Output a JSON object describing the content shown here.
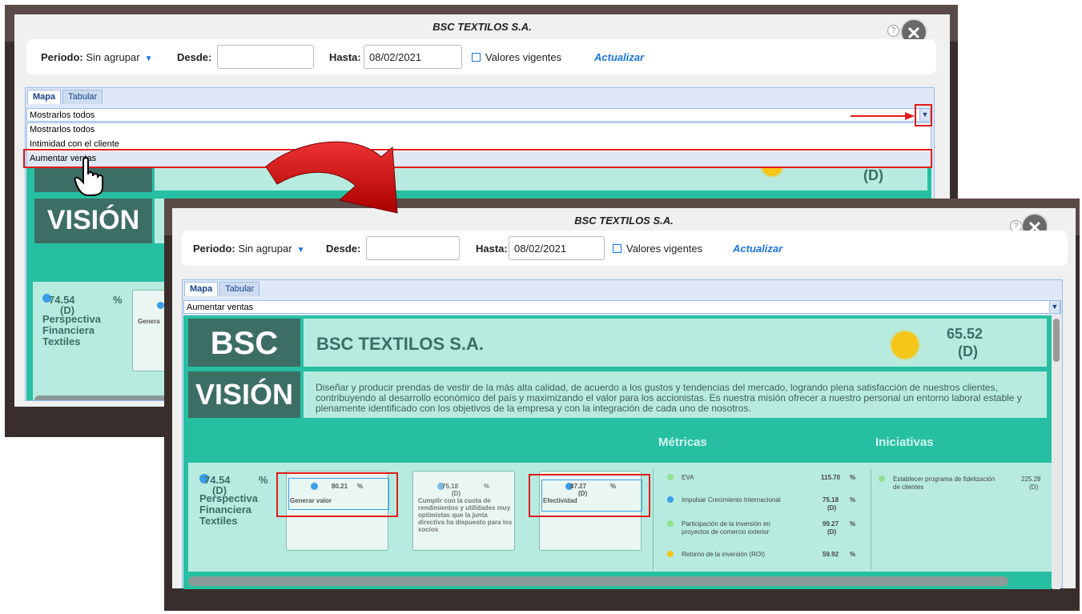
{
  "title": "BSC TEXTILOS S.A.",
  "filters": {
    "periodo_label": "Periodo:",
    "periodo_value": "Sin agrupar",
    "desde_label": "Desde:",
    "desde_value": "",
    "hasta_label": "Hasta:",
    "hasta_value": "08/02/2021",
    "valores_label": "Valores vigentes",
    "actualizar_label": "Actualizar"
  },
  "tabs": [
    "Mapa",
    "Tabular"
  ],
  "back": {
    "combo_value": "Mostrarlos todos",
    "dropdown_options": [
      "Mostrarlos todos",
      "Intimidad con el cliente",
      "Aumentar ventas"
    ],
    "score_fragment": "(D)",
    "vision_label": "VISIÓN",
    "persp_pct": "74.54",
    "persp_unit": "%",
    "persp_flag": "(D)",
    "persp_name": "Perspectiva Financiera Textiles",
    "card_fragment": "Genera"
  },
  "front": {
    "combo_value": "Aumentar ventas",
    "bsc_label": "BSC",
    "org_name": "BSC TEXTILOS S.A.",
    "score_value": "65.52",
    "score_flag": "(D)",
    "vision_label": "VISIÓN",
    "vision_text": "Diseñar y producir prendas de vestir de la más alta calidad, de acuerdo a los gustos y tendencias del mercado, logrando plena satisfacción de nuestros clientes, contribuyendo al desarrollo económico del país y maximizando el valor para los accionistas. Es nuestra misión ofrecer a nuestro personal un entorno laboral estable y plenamente identificado con los objetivos de la empresa y con la integración de cada uno de nosotros.",
    "metricas_label": "Métricas",
    "iniciativas_label": "Iniciativas",
    "perspective": {
      "pct": "74.54",
      "unit": "%",
      "flag": "(D)",
      "name": "Perspectiva Financiera Textiles"
    },
    "objectives": [
      {
        "value": "80.21",
        "unit": "%",
        "flag": "",
        "name": "Generar valor",
        "desc": ""
      },
      {
        "value": "75.18",
        "unit": "%",
        "flag": "(D)",
        "name": "",
        "desc": "Cumplir con la cuota de rendimientos y utilidades muy optimistas que la junta directiva ha dispuesto para los socios"
      },
      {
        "value": "87.27",
        "unit": "%",
        "flag": "(D)",
        "name": "Efectividad",
        "desc": ""
      }
    ],
    "metrics": [
      {
        "name": "EVA",
        "value": "115.70",
        "unit": "%",
        "flag": "",
        "color": "#8fe08f"
      },
      {
        "name": "Impulsar Crecimiento Internacional",
        "value": "75.18",
        "unit": "%",
        "flag": "(D)",
        "color": "#3a9ee8"
      },
      {
        "name": "Participación de la inversión en proyectos de comercio exterior",
        "value": "99.27",
        "unit": "%",
        "flag": "(D)",
        "color": "#8fe08f"
      },
      {
        "name": "Retorno de la inversión (ROI)",
        "value": "59.92",
        "unit": "%",
        "flag": "",
        "color": "#f5c518"
      }
    ],
    "initiatives": [
      {
        "name": "Establecer programa de fidelización de clientes",
        "value": "225.28",
        "flag": "(D)",
        "color": "#8fe08f"
      }
    ]
  },
  "colors": {
    "accent": "#27bfa2",
    "dark_header": "#3d6e65",
    "highlight": "#e31b1b",
    "link": "#1a73e8"
  }
}
